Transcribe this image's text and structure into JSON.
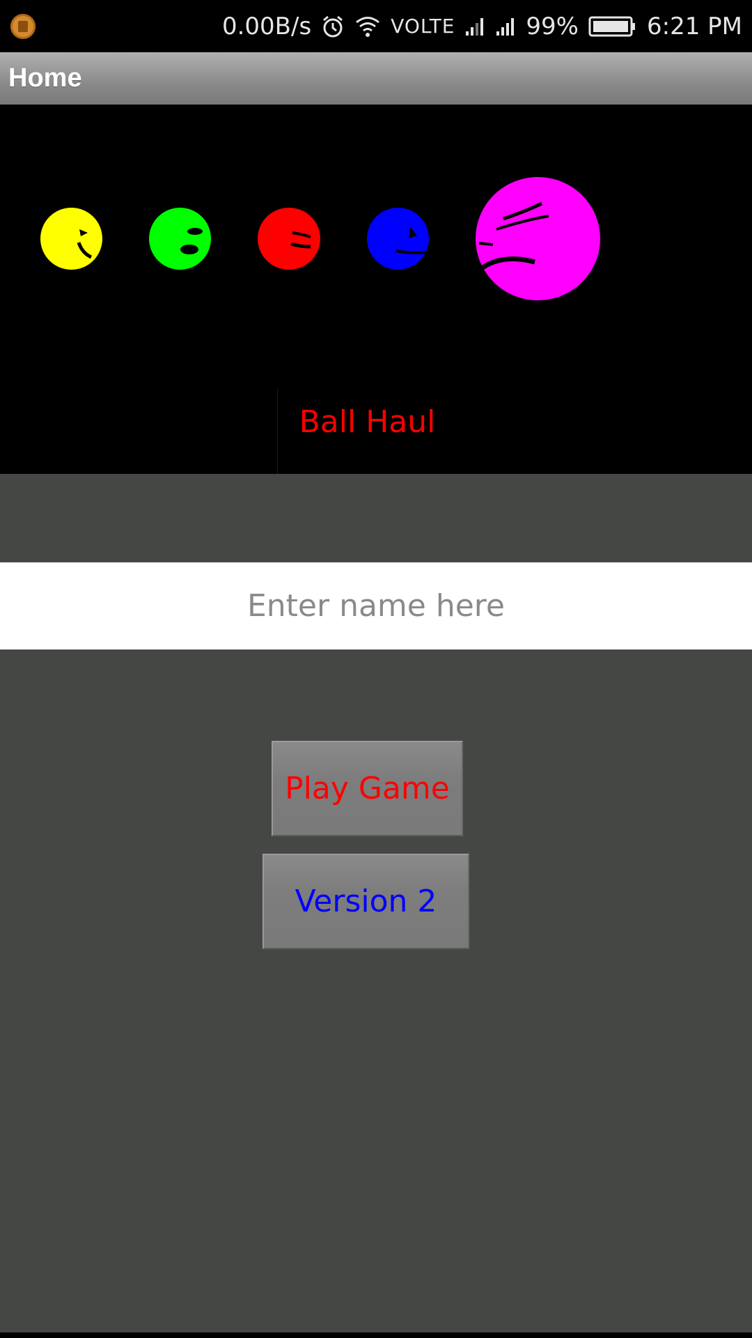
{
  "status_bar": {
    "network_speed": "0.00B/s",
    "network_type": "VOLTE",
    "battery_percent": "99%",
    "time": "6:21 PM",
    "icons": [
      "app-notification-icon",
      "alarm-icon",
      "wifi-icon",
      "signal-icon",
      "battery-icon"
    ]
  },
  "app_bar": {
    "title": "Home"
  },
  "banner": {
    "title": "Ball Haul",
    "title_color": "#ff0000",
    "balls": [
      {
        "name": "yellow-ball",
        "color": "#ffff00"
      },
      {
        "name": "green-ball",
        "color": "#00ff00"
      },
      {
        "name": "red-ball",
        "color": "#ff0000"
      },
      {
        "name": "blue-ball",
        "color": "#0000ff"
      },
      {
        "name": "magenta-ball",
        "color": "#ff00ff"
      }
    ]
  },
  "name_input": {
    "value": "",
    "placeholder": "Enter name here"
  },
  "buttons": {
    "play_game": "Play Game",
    "play_game_color": "#ff0000",
    "version_2": "Version 2",
    "version_2_color": "#0000ff"
  },
  "colors": {
    "background": "#454745",
    "banner_background": "#000000"
  }
}
